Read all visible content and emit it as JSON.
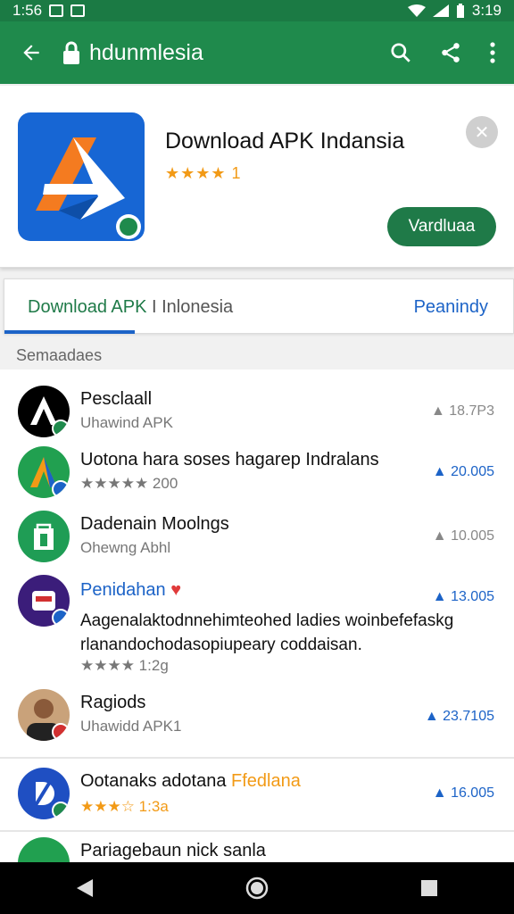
{
  "status": {
    "time_left": "1:56",
    "time_right": "3:19"
  },
  "appbar": {
    "title": "hdunmlesia"
  },
  "app": {
    "title": "Download APK Indansia",
    "rating": "★★★★ 1",
    "install_label": "Vardluaa"
  },
  "tabs": {
    "left_main": "Download APK",
    "left_rest": " I Inlonesia",
    "right": "Peanindy"
  },
  "section_title": "Semaadaes",
  "items": [
    {
      "name": "Pesclaall",
      "sub": "Uhawind APK",
      "meta": "18.7P3"
    },
    {
      "name": "Uotona hara soses hagarep Indralans",
      "sub": "★★★★★ 200",
      "meta": "20.005"
    },
    {
      "name": "Dadenain Moolngs",
      "sub": "Ohewng Abhl",
      "meta": "10.005"
    },
    {
      "name": "Penidahan",
      "meta": "13.005",
      "desc": "Aagenalaktodnnehimteohed ladies woinbefefaskg rlanandochodasopiupeary coddaisan.",
      "sub": "★★★★ 1:2g"
    },
    {
      "name": "Ragiods",
      "sub": "Uhawidd APK1",
      "meta": "23.7105"
    },
    {
      "name": "Ootanaks adotana",
      "name_extra": "Ffedlana",
      "sub": "★★★☆ 1:3a",
      "meta": "16.005"
    },
    {
      "name": "Pariagebaun nick sanla"
    }
  ],
  "colors": {
    "brand_green": "#1f8a4c",
    "accent_blue": "#1c63c7",
    "star_orange": "#f29a16"
  }
}
